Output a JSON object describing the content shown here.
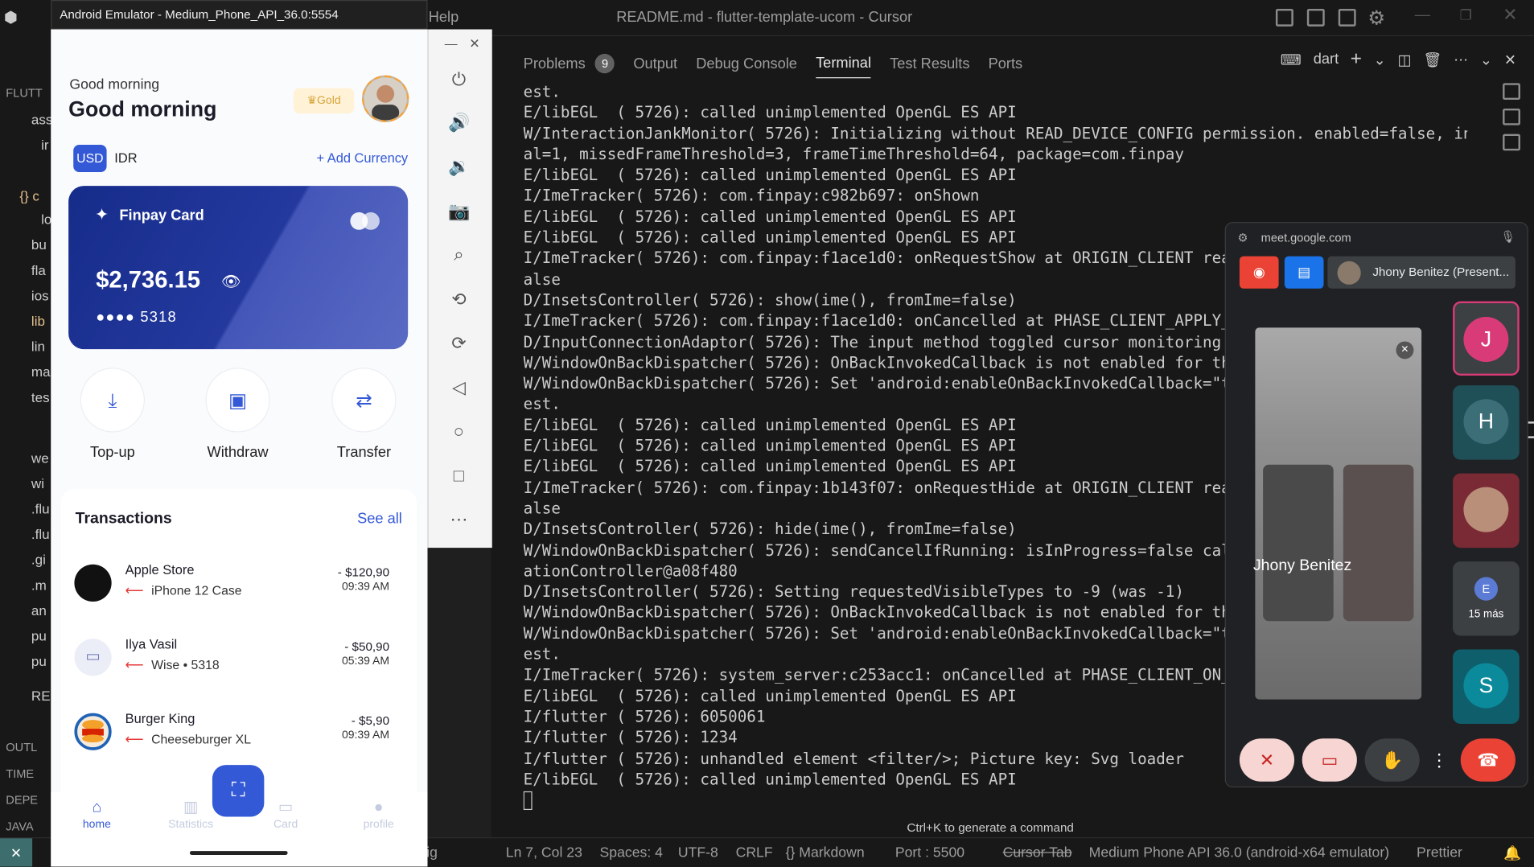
{
  "window": {
    "title": "README.md - flutter-template-ucom - Cursor",
    "menu_help": "Help"
  },
  "explorer": {
    "header": "FLUTT",
    "rows": [
      "ass",
      "ir",
      "",
      "{} c",
      "lo",
      "bu",
      "fla",
      "ios",
      "lib",
      "lin",
      "ma",
      "tes",
      "",
      "we",
      "wi",
      ".flu",
      ".flu",
      ".gi",
      ".m",
      "an",
      "pu",
      "pu",
      "RE"
    ],
    "sections": [
      "OUTL",
      "TIME",
      "DEPE",
      "JAVA"
    ]
  },
  "panel": {
    "tabs": [
      {
        "label": "Problems",
        "badge": "9"
      },
      {
        "label": "Output"
      },
      {
        "label": "Debug Console"
      },
      {
        "label": "Terminal",
        "active": true
      },
      {
        "label": "Test Results"
      },
      {
        "label": "Ports"
      }
    ],
    "terminal_shell": "dart",
    "terminal_lines": [
      "est.",
      "E/libEGL  ( 5726): called unimplemented OpenGL ES API",
      "W/InteractionJankMonitor( 5726): Initializing without READ_DEVICE_CONFIG permission. enabled=false, interv",
      "al=1, missedFrameThreshold=3, frameTimeThreshold=64, package=com.finpay",
      "E/libEGL  ( 5726): called unimplemented OpenGL ES API",
      "I/ImeTracker( 5726): com.finpay:c982b697: onShown",
      "E/libEGL  ( 5726): called unimplemented OpenGL ES API",
      "E/libEGL  ( 5726): called unimplemented OpenGL ES API",
      "I/ImeTracker( 5726): com.finpay:f1ace1d0: onRequestShow at ORIGIN_CLIENT reason",
      "alse",
      "D/InsetsController( 5726): show(ime(), fromIme=false)",
      "I/ImeTracker( 5726): com.finpay:f1ace1d0: onCancelled at PHASE_CLIENT_APPLY_ANI",
      "D/InputConnectionAdaptor( 5726): The input method toggled cursor monitoring on",
      "W/WindowOnBackDispatcher( 5726): OnBackInvokedCallback is not enabled for the a",
      "W/WindowOnBackDispatcher( 5726): Set 'android:enableOnBackInvokedCallback=\"true\"",
      "est.",
      "E/libEGL  ( 5726): called unimplemented OpenGL ES API",
      "E/libEGL  ( 5726): called unimplemented OpenGL ES API",
      "E/libEGL  ( 5726): called unimplemented OpenGL ES API",
      "I/ImeTracker( 5726): com.finpay:1b143f07: onRequestHide at ORIGIN_CLIENT reason",
      "alse",
      "D/InsetsController( 5726): hide(ime(), fromIme=false)",
      "W/WindowOnBackDispatcher( 5726): sendCancelIfRunning: isInProgress=false callba",
      "ationController@a08f480",
      "D/InsetsController( 5726): Setting requestedVisibleTypes to -9 (was -1)",
      "W/WindowOnBackDispatcher( 5726): OnBackInvokedCallback is not enabled for the a",
      "W/WindowOnBackDispatcher( 5726): Set 'android:enableOnBackInvokedCallback=\"true\"",
      "est.",
      "I/ImeTracker( 5726): system_server:c253acc1: onCancelled at PHASE_CLIENT_ON_CON",
      "E/libEGL  ( 5726): called unimplemented OpenGL ES API",
      "I/flutter ( 5726): 6050061",
      "I/flutter ( 5726): 1234",
      "I/flutter ( 5726): unhandled element <filter/>; Picture key: Svg loader",
      "E/libEGL  ( 5726): called unimplemented OpenGL ES API"
    ],
    "hint": "Ctrl+K to generate a command"
  },
  "statusbar": {
    "position": "Ln 7, Col 23",
    "spaces": "Spaces: 4",
    "encoding": "UTF-8",
    "eol": "CRLF",
    "language": "{} Markdown",
    "port": "Port : 5500",
    "cursor_tab": "Cursor Tab",
    "device": "Medium Phone API 36.0 (android-x64 emulator)",
    "prettier": "Prettier",
    "left_fragment": "ig"
  },
  "emulator": {
    "title": "Android Emulator - Medium_Phone_API_36.0:5554",
    "app": {
      "greeting_small": "Good morning",
      "greeting": "Good morning",
      "tier": "Gold",
      "currencies": [
        "USD",
        "IDR"
      ],
      "add_currency": "+ Add Currency",
      "card": {
        "name": "Finpay Card",
        "balance": "$2,736.15",
        "number_mask": "●●●● 5318",
        "brand": "mastercard"
      },
      "actions": [
        "Top-up",
        "Withdraw",
        "Transfer"
      ],
      "transactions_title": "Transactions",
      "see_all": "See all",
      "transactions": [
        {
          "name": "Apple Store",
          "detail": "iPhone 12 Case",
          "amount": "- $120,90",
          "time": "09:39 AM"
        },
        {
          "name": "Ilya Vasil",
          "detail": "Wise • 5318",
          "amount": "- $50,90",
          "time": "05:39 AM"
        },
        {
          "name": "Burger King",
          "detail": "Cheeseburger XL",
          "amount": "- $5,90",
          "time": "09:39 AM"
        }
      ],
      "nav": [
        "home",
        "Statistics",
        "Card",
        "profile"
      ]
    }
  },
  "meet": {
    "url": "meet.google.com",
    "presenter": "Jhony Benitez (Present...",
    "screen_name": "Jhony Benitez",
    "participants": [
      {
        "initial": "J",
        "color": "#d93b78"
      },
      {
        "initial": "H",
        "color": "#1f5c66"
      },
      {
        "initial": "",
        "color": "#7a2a34"
      },
      {
        "initial": "E",
        "label": "15 más",
        "color": "#3c4043"
      },
      {
        "initial": "S",
        "color": "#0b7a8a"
      }
    ]
  }
}
